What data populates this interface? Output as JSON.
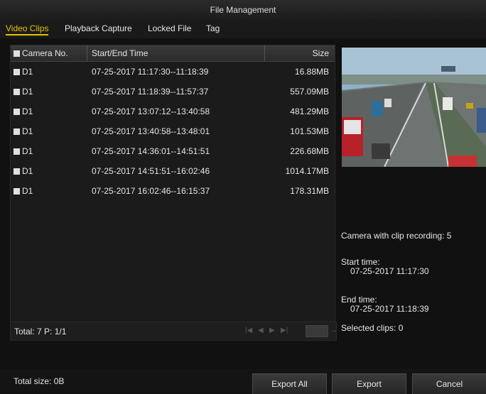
{
  "window": {
    "title": "File Management"
  },
  "tabs": [
    {
      "label": "Video Clips"
    },
    {
      "label": "Playback Capture"
    },
    {
      "label": "Locked File"
    },
    {
      "label": "Tag"
    }
  ],
  "table": {
    "headers": {
      "camera": "Camera No.",
      "time": "Start/End Time",
      "size": "Size"
    },
    "rows": [
      {
        "camera": "D1",
        "time": "07-25-2017 11:17:30--11:18:39",
        "size": "16.88MB"
      },
      {
        "camera": "D1",
        "time": "07-25-2017 11:18:39--11:57:37",
        "size": "557.09MB"
      },
      {
        "camera": "D1",
        "time": "07-25-2017 13:07:12--13:40:58",
        "size": "481.29MB"
      },
      {
        "camera": "D1",
        "time": "07-25-2017 13:40:58--13:48:01",
        "size": "101.53MB"
      },
      {
        "camera": "D1",
        "time": "07-25-2017 14:36:01--14:51:51",
        "size": "226.68MB"
      },
      {
        "camera": "D1",
        "time": "07-25-2017 14:51:51--16:02:46",
        "size": "1014.17MB"
      },
      {
        "camera": "D1",
        "time": "07-25-2017 16:02:46--16:15:37",
        "size": "178.31MB"
      }
    ]
  },
  "footer": {
    "total": "Total: 7  P: 1/1"
  },
  "info": {
    "camera_count": "Camera with clip recording: 5",
    "start_label": "Start time:",
    "start_value": "07-25-2017 11:17:30",
    "end_label": "End time:",
    "end_value": "07-25-2017 11:18:39",
    "selected": "Selected clips: 0"
  },
  "bottom": {
    "total_size": "Total size: 0B",
    "export_all": "Export All",
    "export": "Export",
    "cancel": "Cancel"
  },
  "icons": {
    "pager": [
      "first-page-icon",
      "prev-page-icon",
      "next-page-icon",
      "last-page-icon",
      "go-page-icon"
    ]
  },
  "colors": {
    "accent": "#e8c200",
    "background": "#111111",
    "panel": "#1b1b1b"
  }
}
